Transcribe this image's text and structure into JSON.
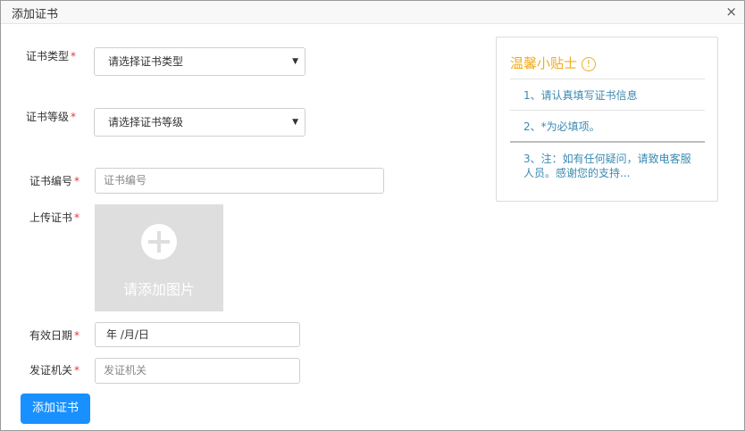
{
  "dialog": {
    "title": "添加证书",
    "close": "×"
  },
  "form": {
    "cert_type": {
      "label": "证书类型",
      "required": "*",
      "value": "请选择证书类型",
      "arrow": "▼"
    },
    "cert_level": {
      "label": "证书等级",
      "required": "*",
      "value": "请选择证书等级",
      "arrow": "▼"
    },
    "cert_number": {
      "label": "证书编号",
      "required": "*",
      "placeholder": "证书编号"
    },
    "upload": {
      "label": "上传证书",
      "required": "*",
      "text": "请添加图片"
    },
    "valid_date": {
      "label": "有效日期",
      "required": "*",
      "value": "年 /月/日"
    },
    "issuer": {
      "label": "发证机关",
      "required": "*",
      "placeholder": "发证机关"
    },
    "submit_label": "添加证书"
  },
  "tips": {
    "title": "温馨小贴士",
    "icon": "!",
    "items": [
      "1、请认真填写证书信息",
      "2、*为必填项。",
      "3、注：如有任何疑问，请致电客服人员。感谢您的支持..."
    ]
  },
  "colors": {
    "primary": "#1890ff",
    "required": "#e53935",
    "tips_title": "#f0ad1d",
    "tips_text": "#3a8ab0"
  }
}
